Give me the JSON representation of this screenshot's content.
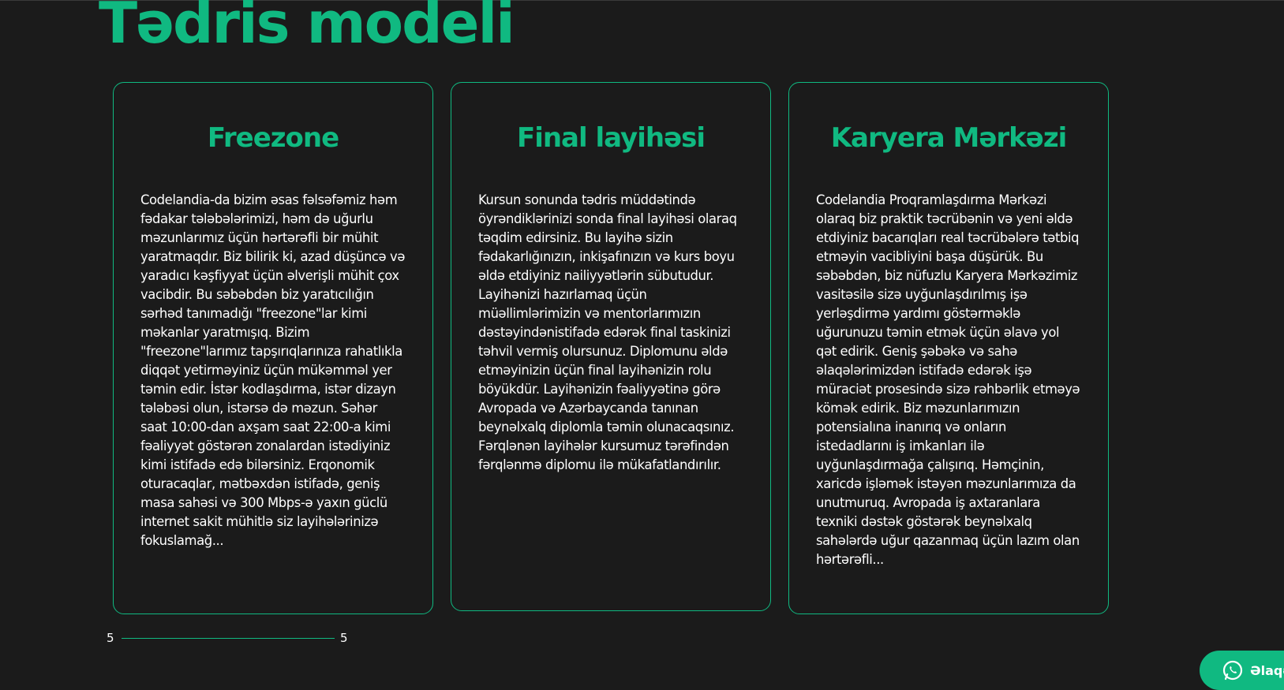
{
  "page": {
    "title": "Tədris modeli"
  },
  "cards": [
    {
      "title": "Freezone",
      "body": "Codelandia-da bizim əsas fəlsəfəmiz həm fədakar tələbələrimizi, həm də uğurlu məzunlarımız üçün hərtərəfli bir mühit yaratmaqdır. Biz bilirik ki, azad düşüncə və yaradıcı kəşfiyyat üçün əlverişli mühit çox vacibdir. Bu səbəbdən biz yaratıcılığın sərhəd tanımadığı \"freezone\"lar kimi məkanlar yaratmışıq. Bizim \"freezone\"larımız tapşırıqlarınıza rahatlıkla diqqət yetirməyiniz üçün mükəmməl yer təmin edir. İstər kodlaşdırma, istər dizayn tələbəsi olun, istərsə də məzun. Səhər saat 10:00-dan axşam saat 22:00-a kimi fəaliyyət göstərən zonalardan istədiyiniz kimi istifadə edə bilərsiniz. Erqonomik oturacaqlar, mətbəxdən istifadə, geniş masa sahəsi və 300 Mbps-ə yaxın güclü internet sakit mühitlə siz layihələrinizə fokuslamağ..."
    },
    {
      "title": "Final layihəsi",
      "body": "Kursun sonunda tədris müddətində öyrəndiklərinizi sonda final layihəsi olaraq təqdim edirsiniz. Bu layihə sizin fədakarlığınızın, inkişafınızın və kurs boyu əldə etdiyiniz nailiyyətlərin sübutudur. Layihənizi hazırlamaq üçün müəllimlərimizin və mentorlarımızın dəstəyindənistifadə edərək final taskinizi təhvil vermiş olursunuz. Diplomunu əldə etməyinizin üçün final layihənizin rolu böyükdür. Layihənizin fəaliyyətinə görə Avropada və Azərbaycanda tanınan beynəlxalq diplomla təmin olunacaqsınız. Fərqlənən layihələr kursumuz tərəfindən fərqlənmə diplomu ilə mükafatlandırılır."
    },
    {
      "title": "Karyera Mərkəzi",
      "body": "Codelandia Proqramlaşdırma Mərkəzi olaraq biz praktik təcrübənin və yeni əldə etdiyiniz bacarıqları real təcrübələrə tətbiq etməyin vacibliyini başa düşürük. Bu səbəbdən, biz nüfuzlu Karyera Mərkəzimiz vasitəsilə sizə uyğunlaşdırılmış işə yerləşdirmə yardımı göstərməklə uğurunuzu təmin etmək üçün əlavə yol qət edirik. Geniş şəbəkə və sahə əlaqələrimizdən istifadə edərək işə müraciət prosesində sizə rəhbərlik etməyə kömək edirik. Biz məzunlarımızın potensialına inanırıq və onların istedadlarını iş imkanları ilə uyğunlaşdırmağa çalışırıq. Həmçinin, xaricdə işləmək istəyən məzunlarımıza da unutmuruq. Avropada iş axtaranlara texniki dəstək göstərək beynəlxalq sahələrdə uğur qazanmaq üçün lazım olan hərtərəfli..."
    }
  ],
  "pager": {
    "current": "5",
    "total": "5"
  },
  "contact": {
    "label": "Əlaqə s",
    "icon": "whatsapp-icon"
  },
  "colors": {
    "accent": "#10b981",
    "background": "#1b1b1b",
    "text": "#ffffff"
  }
}
